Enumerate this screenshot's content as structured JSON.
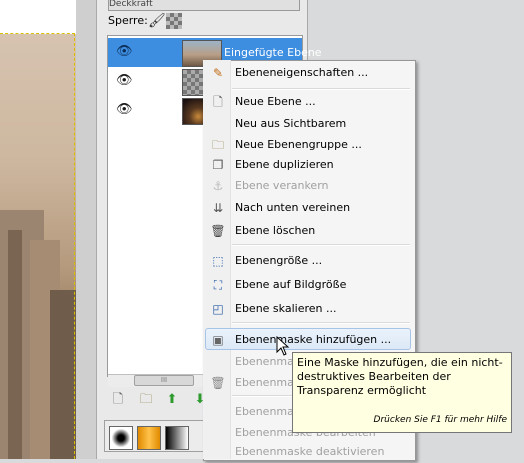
{
  "dock": {
    "header_text": "Deckkraft",
    "lock_label": "Sperre:",
    "icons": {
      "lock_brush": "paintbrush-icon",
      "lock_alpha": "alpha-checker-icon"
    }
  },
  "layers": [
    {
      "name": "Eingefügte Ebene",
      "visible": true,
      "selected": true,
      "thumb": "city"
    },
    {
      "name": "",
      "visible": true,
      "selected": false,
      "thumb": "checker"
    },
    {
      "name": "",
      "visible": true,
      "selected": false,
      "thumb": "night"
    }
  ],
  "scrollbar": {
    "thumb_label": "III"
  },
  "context_menu": {
    "items": [
      {
        "label": "Ebeneneigenschaften ...",
        "icon": "edit-properties-icon",
        "disabled": false
      },
      {
        "label": "Neue Ebene ...",
        "icon": "new-page-icon",
        "disabled": false
      },
      {
        "label": "Neu aus Sichtbarem",
        "icon": "",
        "disabled": false
      },
      {
        "label": "Neue Ebenengruppe ...",
        "icon": "folder-icon",
        "disabled": false
      },
      {
        "label": "Ebene duplizieren",
        "icon": "duplicate-icon",
        "disabled": false
      },
      {
        "label": "Ebene verankern",
        "icon": "anchor-icon",
        "disabled": true
      },
      {
        "label": "Nach unten vereinen",
        "icon": "merge-down-icon",
        "disabled": false
      },
      {
        "label": "Ebene löschen",
        "icon": "trash-icon",
        "disabled": false
      },
      {
        "label": "Ebenengröße ...",
        "icon": "layer-size-icon",
        "disabled": false
      },
      {
        "label": "Ebene auf Bildgröße",
        "icon": "fit-to-image-icon",
        "disabled": false
      },
      {
        "label": "Ebene skalieren ...",
        "icon": "scale-icon",
        "disabled": false
      },
      {
        "label": "Ebenenmaske hinzufügen ...",
        "icon": "add-mask-icon",
        "disabled": false,
        "highlighted": true
      },
      {
        "label": "Ebenenmaske anwenden",
        "icon": "",
        "disabled": true
      },
      {
        "label": "Ebenenmaske löschen",
        "icon": "trash-icon",
        "disabled": true
      },
      {
        "label": "Ebenenmaske anzeigen",
        "icon": "",
        "disabled": true
      },
      {
        "label": "Ebenenmaske bearbeiten",
        "icon": "",
        "disabled": true
      },
      {
        "label": "Ebenenmaske deaktivieren",
        "icon": "",
        "disabled": true
      }
    ]
  },
  "tooltip": {
    "text": "Eine Maske hinzufügen, die ein nicht-destruktives Bearbeiten der Transparenz ermöglicht",
    "help": "Drücken Sie F1 für mehr Hilfe"
  }
}
